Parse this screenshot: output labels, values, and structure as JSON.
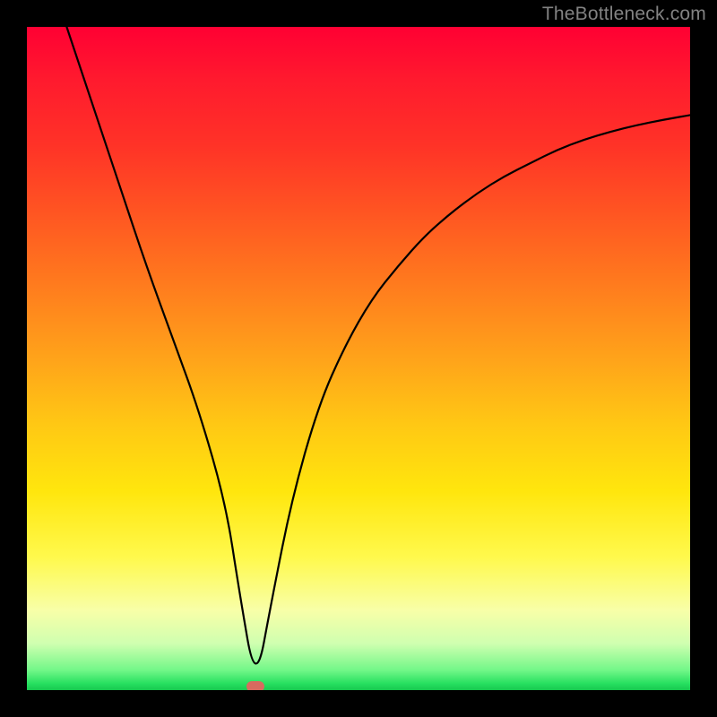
{
  "watermark": {
    "text": "TheBottleneck.com"
  },
  "chart_data": {
    "type": "line",
    "title": "",
    "xlabel": "",
    "ylabel": "",
    "xlim": [
      0,
      100
    ],
    "ylim": [
      0,
      100
    ],
    "legend": false,
    "background_gradient": {
      "top": "#ff0033",
      "mid": "#ffe000",
      "bottom_accent": "#20d858",
      "description": "vertical red→orange→yellow→green gradient, green only at very bottom"
    },
    "series": [
      {
        "name": "bottleneck-curve",
        "color": "#000000",
        "x": [
          6,
          10,
          14,
          18,
          22,
          26,
          30,
          32,
          34.5,
          37,
          40,
          44,
          48,
          52,
          56,
          60,
          64,
          68,
          72,
          76,
          80,
          84,
          88,
          92,
          96,
          100
        ],
        "values": [
          100,
          88,
          76,
          64,
          53,
          42,
          28,
          15,
          0.5,
          14,
          29,
          43,
          52,
          59,
          64,
          68.5,
          72,
          75,
          77.5,
          79.5,
          81.5,
          83,
          84.2,
          85.2,
          86,
          86.7
        ]
      }
    ],
    "marker": {
      "name": "optimal-point",
      "color": "#d86a5f",
      "x": 34.5,
      "y": 0.5
    }
  }
}
